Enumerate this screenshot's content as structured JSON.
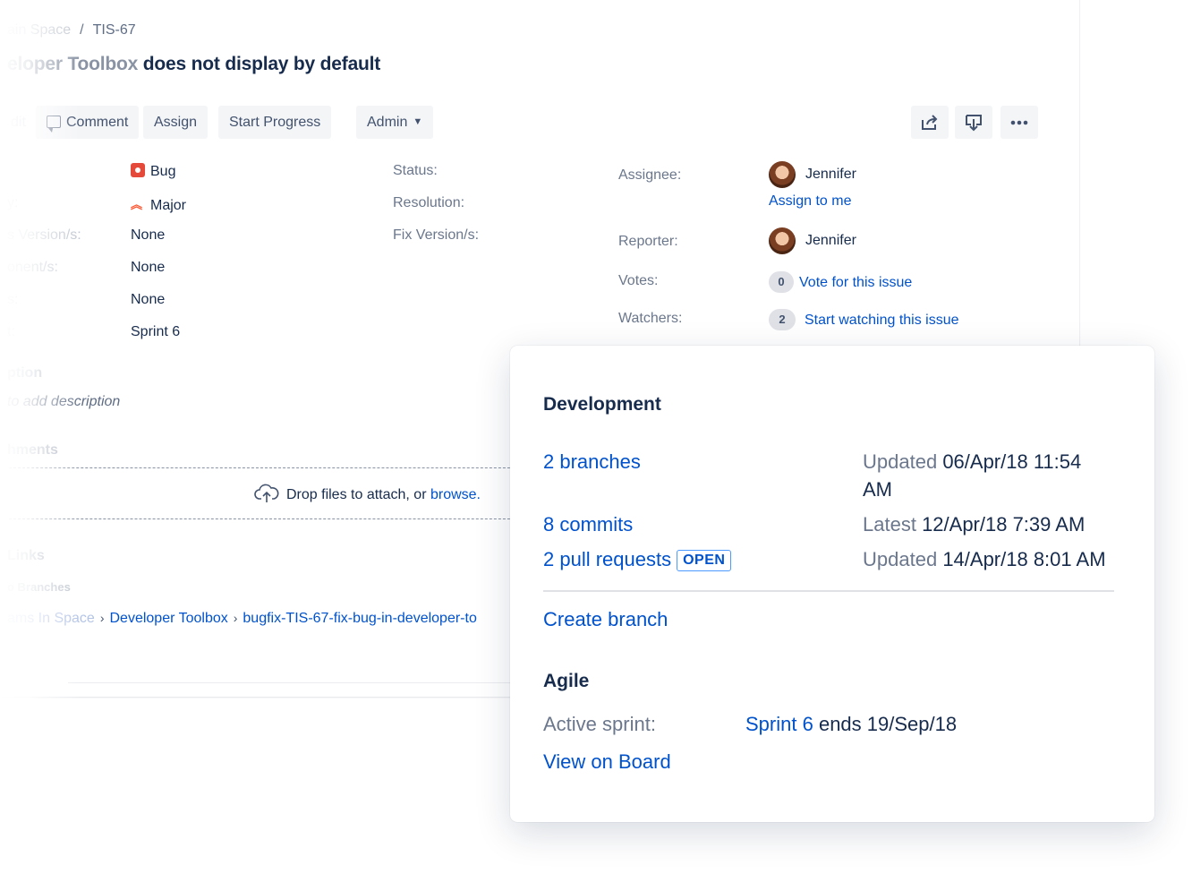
{
  "breadcrumb": {
    "project": "ain Space",
    "separator": "/",
    "issue_key": "TIS-67"
  },
  "issue": {
    "title_faded": "eloper Toolbox",
    "title_main": "does not display by default"
  },
  "toolbar": {
    "edit_label": "dit",
    "comment_label": "Comment",
    "assign_label": "Assign",
    "start_progress_label": "Start Progress",
    "admin_label": "Admin",
    "share_icon": "share-icon",
    "export_icon": "export-icon",
    "more_icon": "more-icon"
  },
  "details": {
    "type_label": "",
    "type_value": "Bug",
    "priority_label": "y:",
    "priority_value": "Major",
    "affects_label": "s Version/s:",
    "affects_value": "None",
    "components_label": "onent/s:",
    "components_value": "None",
    "labels_label": "s:",
    "labels_value": "None",
    "sprint_label": "t:",
    "sprint_value": "Sprint 6",
    "status_label": "Status:",
    "resolution_label": "Resolution:",
    "fix_version_label": "Fix Version/s:"
  },
  "people": {
    "assignee_label": "Assignee:",
    "assignee_name": "Jennifer",
    "assign_to_me": "Assign to me",
    "reporter_label": "Reporter:",
    "reporter_name": "Jennifer",
    "votes_label": "Votes:",
    "votes_count": "0",
    "vote_link": "Vote for this issue",
    "watchers_label": "Watchers:",
    "watchers_count": "2",
    "watch_link": "Start watching this issue"
  },
  "description": {
    "heading": "ption",
    "placeholder": "to add description"
  },
  "attachments": {
    "heading": "hments",
    "drop_text": "Drop files to attach, or",
    "browse_link": "browse."
  },
  "links": {
    "heading": "Links",
    "branches_heading": "o Branches",
    "path": {
      "repo_faded": "ams In Space",
      "sep1": "›",
      "project": "Developer Toolbox",
      "sep2": "›",
      "branch": "bugfix-TIS-67-fix-bug-in-developer-to"
    }
  },
  "development": {
    "title": "Development",
    "branches_link": "2 branches",
    "branches_meta_label": "Updated",
    "branches_meta_value": "06/Apr/18 11:54",
    "branches_meta_value2": "AM",
    "commits_link": "8 commits",
    "commits_meta_label": "Latest",
    "commits_meta_value": "12/Apr/18 7:39 AM",
    "prs_link": "2 pull requests",
    "prs_badge": "OPEN",
    "prs_meta_label": "Updated",
    "prs_meta_value": "14/Apr/18 8:01 AM",
    "create_branch": "Create branch"
  },
  "agile": {
    "title": "Agile",
    "active_sprint_label": "Active sprint:",
    "sprint_link": "Sprint 6",
    "sprint_ends": "ends 19/Sep/18",
    "view_on_board": "View on Board"
  },
  "colors": {
    "link": "#0052cc",
    "text": "#172b4d",
    "muted": "#6b778c",
    "bug": "#e5493a",
    "major": "#ff5630"
  }
}
